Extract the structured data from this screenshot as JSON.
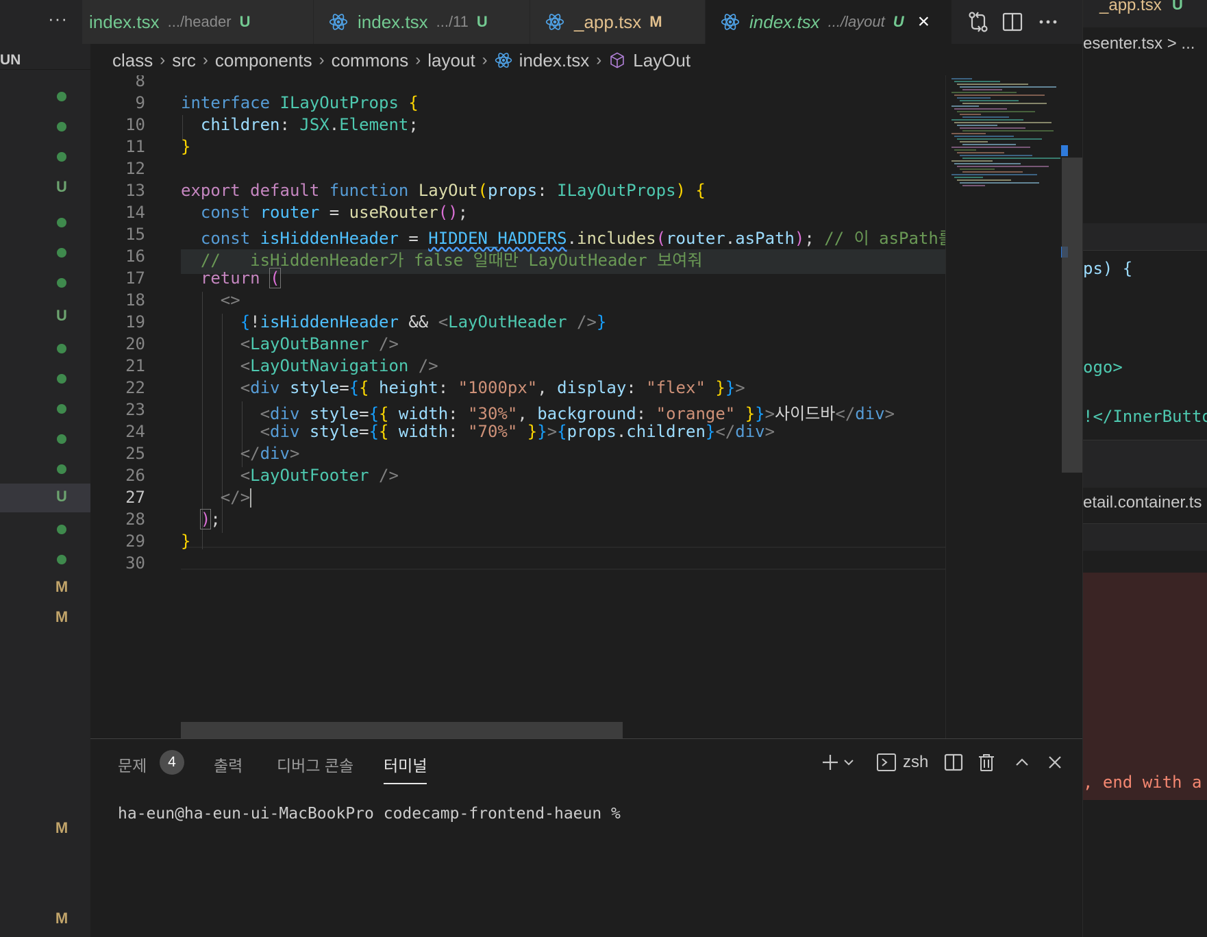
{
  "explorer": {
    "header": "UN",
    "markers": [
      {
        "kind": "dot",
        "label": ""
      },
      {
        "kind": "dot",
        "label": ""
      },
      {
        "kind": "dot",
        "label": ""
      },
      {
        "kind": "u",
        "label": "U"
      },
      {
        "kind": "dot",
        "label": ""
      },
      {
        "kind": "dot",
        "label": ""
      },
      {
        "kind": "dot",
        "label": ""
      },
      {
        "kind": "u",
        "label": "U"
      },
      {
        "kind": "dot",
        "label": ""
      },
      {
        "kind": "dot",
        "label": ""
      },
      {
        "kind": "dot",
        "label": ""
      },
      {
        "kind": "dot",
        "label": ""
      },
      {
        "kind": "dot",
        "label": ""
      },
      {
        "kind": "u",
        "label": "U"
      },
      {
        "kind": "dot",
        "label": ""
      },
      {
        "kind": "dot",
        "label": ""
      },
      {
        "kind": "m",
        "label": "M"
      },
      {
        "kind": "m",
        "label": "M"
      },
      {
        "kind": "m",
        "label": "M"
      },
      {
        "kind": "m",
        "label": "M"
      }
    ]
  },
  "tabs": [
    {
      "name": "index.tsx",
      "dir": ".../header",
      "status": "U"
    },
    {
      "name": "index.tsx",
      "dir": ".../11",
      "status": "U"
    },
    {
      "name": "_app.tsx",
      "dir": "",
      "status": "M"
    },
    {
      "name": "index.tsx",
      "dir": ".../layout",
      "status": "U",
      "close": "×"
    }
  ],
  "tabbar": {
    "more": "···"
  },
  "breadcrumb": [
    "class",
    "src",
    "components",
    "commons",
    "layout",
    "index.tsx",
    "LayOut"
  ],
  "editor": {
    "line_numbers": [
      "8",
      "9",
      "10",
      "11",
      "12",
      "13",
      "14",
      "15",
      "16",
      "17",
      "18",
      "19",
      "20",
      "21",
      "22",
      "23",
      "24",
      "25",
      "26",
      "27",
      "28",
      "29",
      "30"
    ],
    "current_line": "27",
    "comment15": "// 이 asPath를",
    "comment16": "//   isHiddenHeader가 false 일때만 LayOutHeader 보여줘",
    "sidebar_text": "사이드바"
  },
  "panel": {
    "tabs": [
      "문제",
      "출력",
      "디버그 콘솔",
      "터미널"
    ],
    "problems_count": "4",
    "shell": "zsh",
    "prompt": "ha-eun@ha-eun-ui-MacBookPro codecamp-frontend-haeun %"
  },
  "peek": {
    "tab": "_app.tsx",
    "tab_status": "U",
    "crumb": "esenter.tsx > ...",
    "line1": "ps) {",
    "line2": "ogo>",
    "line3": "!</InnerButton",
    "file": "etail.container.ts",
    "error": ", end with a"
  }
}
